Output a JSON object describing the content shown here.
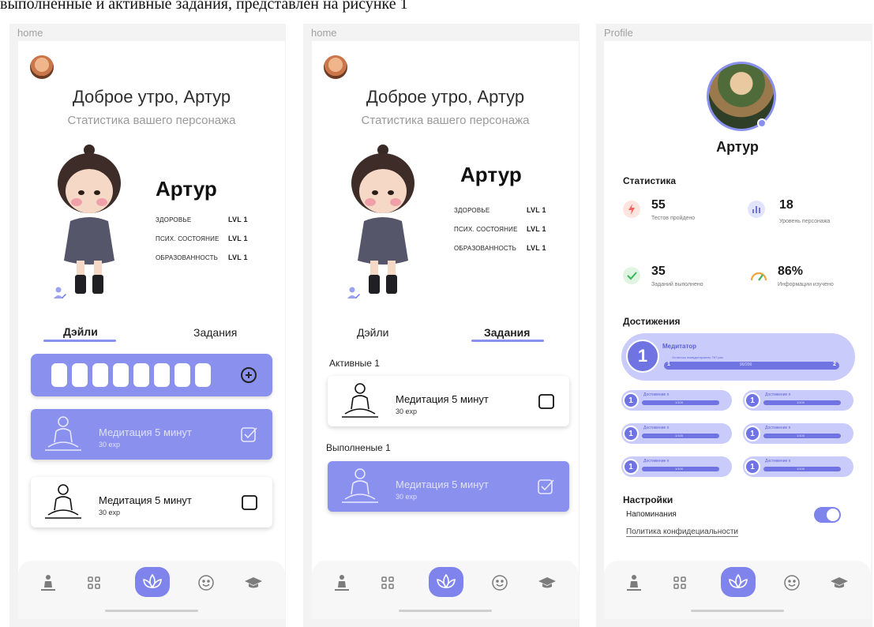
{
  "caption": "выполненные и активные задания, представлен на рисунке 1",
  "screens": {
    "home1": {
      "label": "home"
    },
    "home2": {
      "label": "home"
    },
    "profile": {
      "label": "Profile"
    }
  },
  "greeting": "Доброе утро, Артур",
  "greeting_sub": "Статистика вашего персонажа",
  "character": {
    "name": "Артур",
    "stats": [
      {
        "label": "ЗДОРОВЬЕ",
        "level": "LVL 1"
      },
      {
        "label": "ПСИХ. СОСТОЯНИЕ",
        "level": "LVL 1"
      },
      {
        "label": "ОБРАЗОВАННОСТЬ",
        "level": "LVL 1"
      }
    ]
  },
  "tabs": {
    "daily": "Дэйли",
    "tasks": "Задания"
  },
  "task": {
    "title": "Медитация 5 минут",
    "xp": "30 exp"
  },
  "sections": {
    "active": "Активные 1",
    "completed": "Выполненые 1"
  },
  "profile": {
    "name": "Артур",
    "stats_title": "Статистика",
    "stats": {
      "tests": {
        "value": "55",
        "label": "Тестов пройдено"
      },
      "level": {
        "value": "18",
        "label": "Уровень персонажа"
      },
      "tasks": {
        "value": "35",
        "label": "Заданий выполнено"
      },
      "info": {
        "value": "86%",
        "label": "Информации изучено"
      }
    },
    "achievements_title": "Достижения",
    "main_achievement": {
      "number": "1",
      "title": "Медитатор",
      "desc": "Осталось помедитировать 767 раз",
      "from": "1",
      "to": "2",
      "progress_text": "90/200",
      "progress": 0.45
    },
    "achievement_item": {
      "number": "1",
      "title": "Достижение n",
      "progress_text": "1/100"
    },
    "settings_title": "Настройки",
    "reminders_label": "Напоминания",
    "reminders_on": true,
    "privacy_link": "Политика конфидециальности"
  },
  "nav": [
    "meditation-icon",
    "grid-icon",
    "lotus-icon",
    "smile-icon",
    "graduation-cap-icon"
  ],
  "colors": {
    "accent": "#8a90ee",
    "accent_dark": "#6f74e2",
    "accent_light": "#c9ccfa"
  }
}
